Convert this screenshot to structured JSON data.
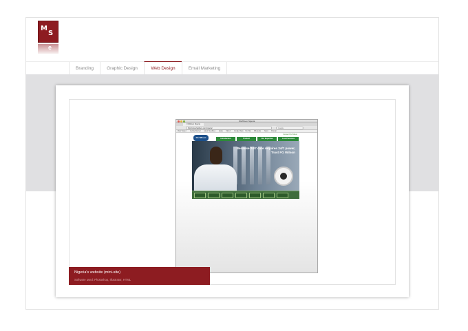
{
  "logo": {
    "letters_top": "M",
    "letters_side": "S",
    "letters_reflection": "e"
  },
  "nav": {
    "items": [
      {
        "label": "Branding",
        "active": false
      },
      {
        "label": "Graphic Design",
        "active": false
      },
      {
        "label": "Web Design",
        "active": true
      },
      {
        "label": "Email Marketing",
        "active": false
      }
    ]
  },
  "colors": {
    "accent": "#8d1c21",
    "band": "#e0e0e2",
    "site_green": "#2d8a3a"
  },
  "browser": {
    "title": "FGWilson Nigeria",
    "tab": "FGWilson Nigeria",
    "url": "http://www.fgwilson.com/nigeria/",
    "search_placeholder": "Google",
    "bookmarks": [
      "Most Visited",
      "Getting Started",
      "Latest Headlines",
      "Apple",
      "Yahoo!",
      "Google Maps",
      "YouTube",
      "Wikipedia",
      "News",
      "Popular"
    ]
  },
  "site": {
    "logo": "FG Wilson",
    "top_right": "Contact FG Wilson",
    "nav": [
      "Introduction",
      "Product",
      "Our Expertise",
      "Local Services"
    ],
    "hero_headline": "Because 24/7 care requires 24/7 power,",
    "hero_subline": "Trust FG Wilson"
  },
  "caption": {
    "title": "Nigeria's website (mini-site)",
    "subtitle": "Software used: Photoshop, Illustrator, HTML"
  }
}
